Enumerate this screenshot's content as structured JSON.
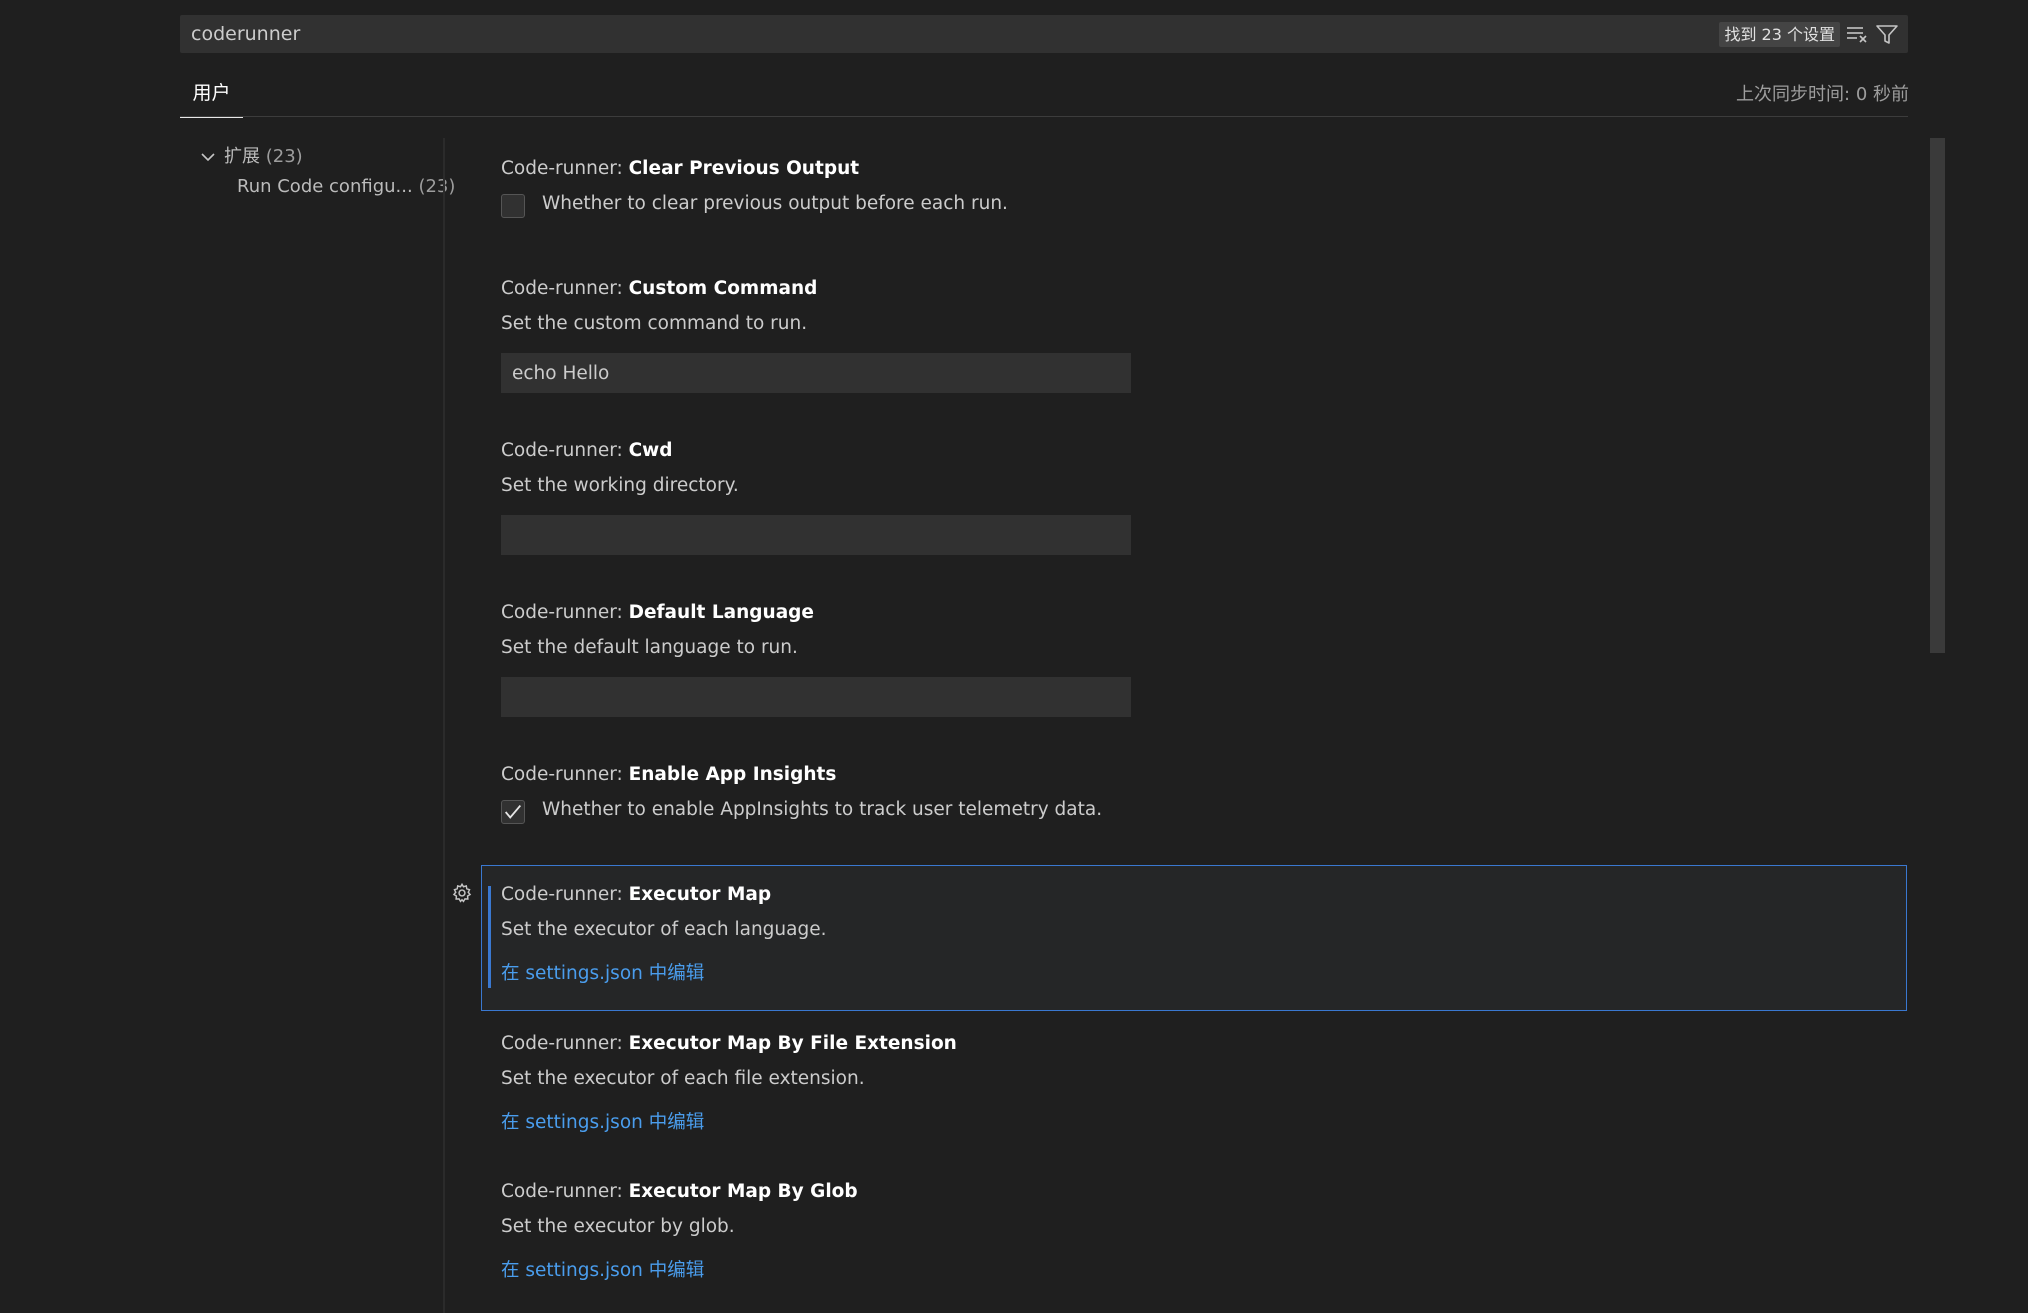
{
  "search": {
    "value": "coderunner",
    "result_count": "找到 23 个设置"
  },
  "icons": {
    "clear_filter": "clear-filter-icon",
    "filter": "filter-icon",
    "chevron": "chevron-down-icon",
    "gear": "gear-icon",
    "check": "check-icon"
  },
  "tabs": {
    "user": "用户",
    "sync_status": "上次同步时间: 0 秒前"
  },
  "toc": {
    "extensions_label": "扩展",
    "extensions_count": "(23)",
    "run_code_label": "Run Code configu...",
    "run_code_count": "(23)"
  },
  "settings": [
    {
      "category": "Code-runner: ",
      "name": "Clear Previous Output",
      "description": "Whether to clear previous output before each run.",
      "checked": false
    },
    {
      "category": "Code-runner: ",
      "name": "Custom Command",
      "description": "Set the custom command to run.",
      "value": "echo Hello"
    },
    {
      "category": "Code-runner: ",
      "name": "Cwd",
      "description": "Set the working directory.",
      "value": ""
    },
    {
      "category": "Code-runner: ",
      "name": "Default Language",
      "description": "Set the default language to run.",
      "value": ""
    },
    {
      "category": "Code-runner: ",
      "name": "Enable App Insights",
      "description": "Whether to enable AppInsights to track user telemetry data.",
      "checked": true
    },
    {
      "category": "Code-runner: ",
      "name": "Executor Map",
      "description": "Set the executor of each language.",
      "link": "在 settings.json 中编辑"
    },
    {
      "category": "Code-runner: ",
      "name": "Executor Map By File Extension",
      "description": "Set the executor of each file extension.",
      "link": "在 settings.json 中编辑"
    },
    {
      "category": "Code-runner: ",
      "name": "Executor Map By Glob",
      "description": "Set the executor by glob.",
      "link": "在 settings.json 中编辑"
    }
  ],
  "colors": {
    "background": "#1f1f1f",
    "focus_border": "#3a78d0",
    "link": "#4a9ded"
  }
}
